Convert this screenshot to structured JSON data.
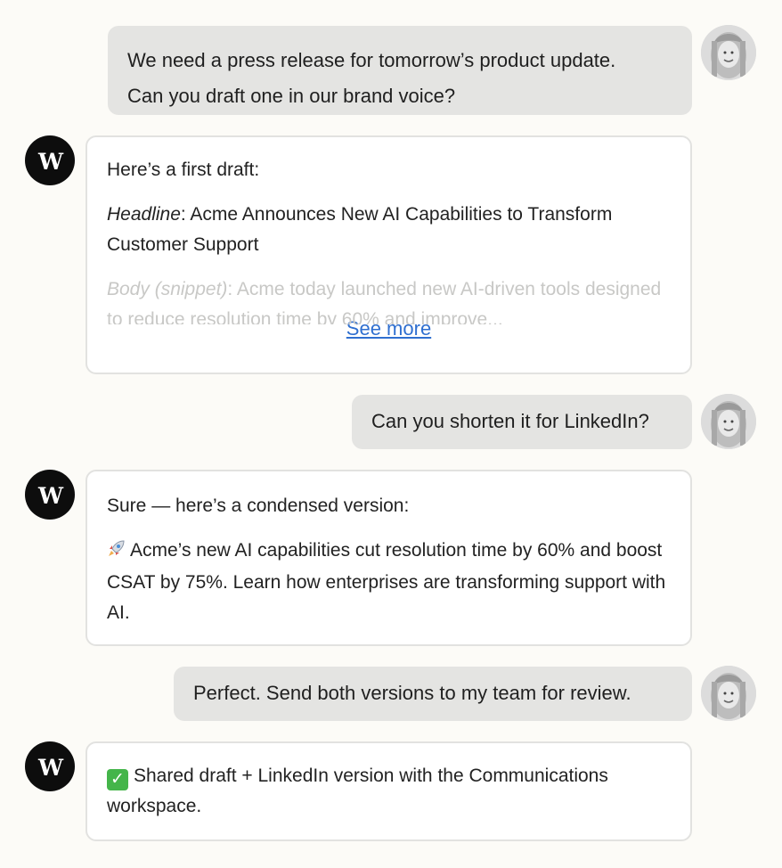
{
  "messages": [
    {
      "role": "user",
      "lines": [
        "We need a press release for tomorrow’s product update.",
        "Can you draft one in our brand voice?"
      ]
    },
    {
      "role": "assistant",
      "intro": "Here’s a first draft:",
      "headline_label": "Headline",
      "headline_text": ": Acme Announces New AI Capabilities to Transform Customer Support",
      "body_label": "Body (snippet)",
      "body_text": ": Acme today launched new AI-driven tools designed to reduce resolution time by 60% and improve...",
      "see_more": "See more"
    },
    {
      "role": "user",
      "lines": [
        "Can you shorten it for LinkedIn?"
      ]
    },
    {
      "role": "assistant",
      "intro": "Sure — here’s a condensed version:",
      "emoji": "rocket-icon",
      "text": "Acme’s new AI capabilities cut resolution time by 60% and boost CSAT by 75%. Learn how enterprises are transforming support with AI."
    },
    {
      "role": "user",
      "lines": [
        "Perfect. Send both versions to my team for review."
      ]
    },
    {
      "role": "assistant",
      "emoji": "check-mark-icon",
      "text": "Shared draft + LinkedIn version with the Communications workspace."
    }
  ],
  "assistant_logo": "W",
  "colors": {
    "background": "#fcfbf7",
    "user_bubble": "#e4e4e2",
    "assistant_bubble_border": "#e2e2e0",
    "logo": "#0d0d0d",
    "link": "#2f6fd0",
    "check": "#44b54a"
  }
}
